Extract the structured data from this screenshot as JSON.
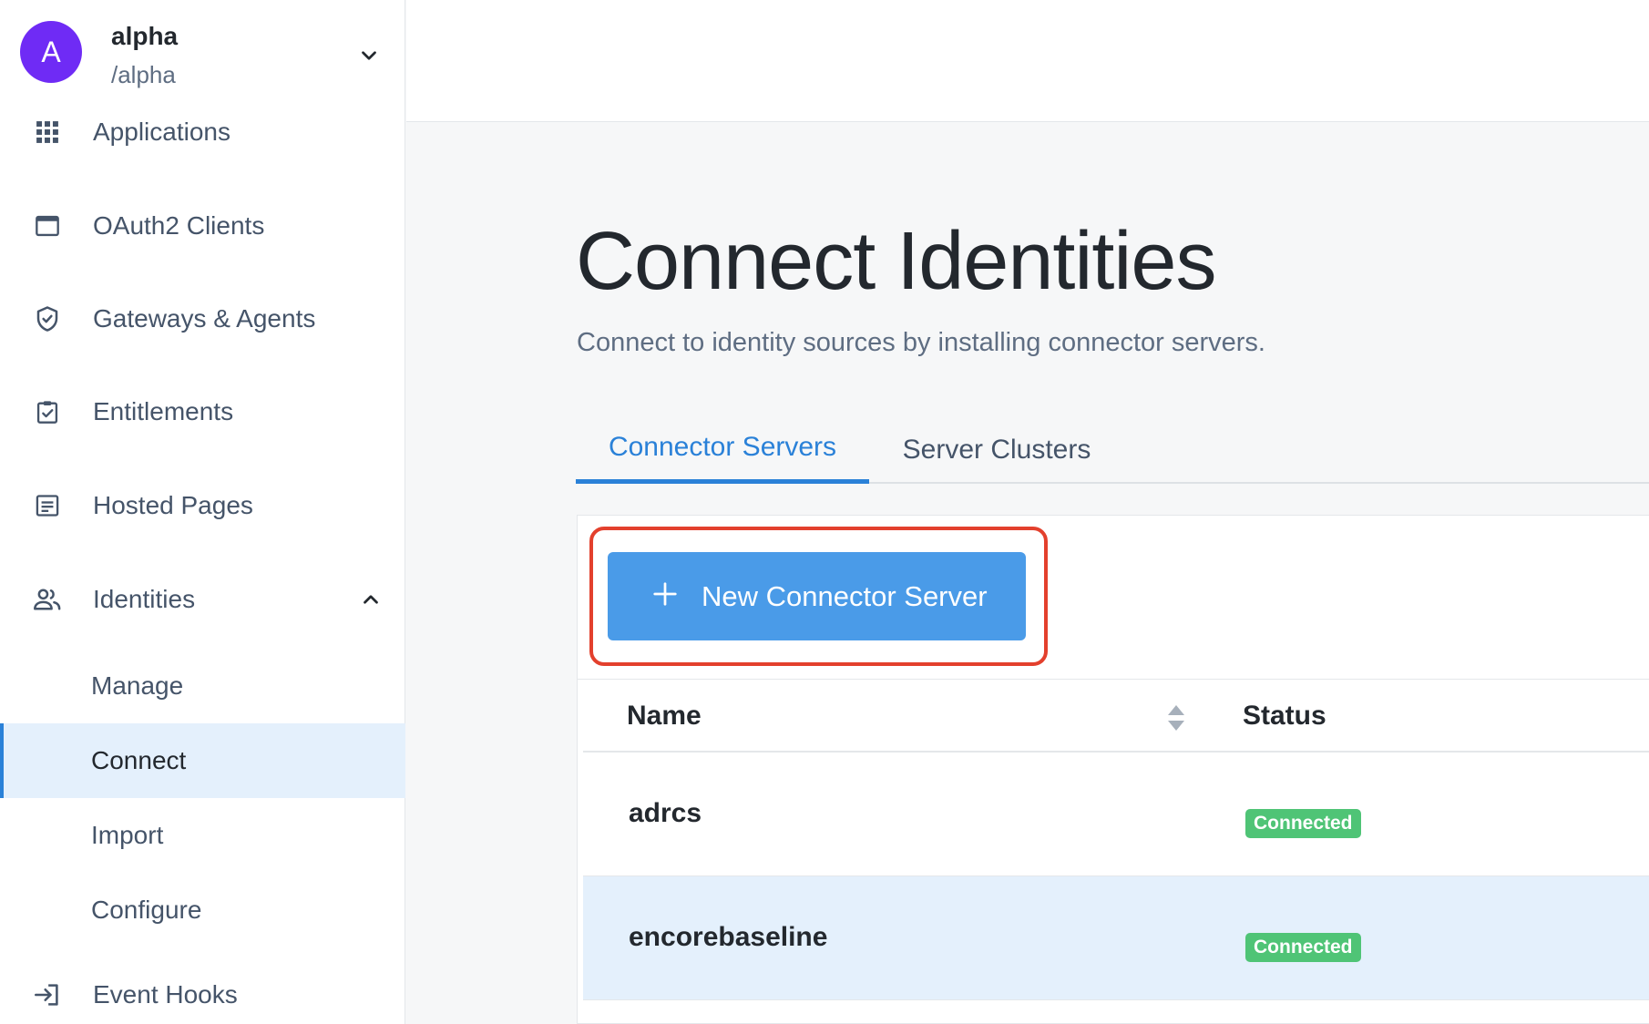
{
  "realm": {
    "initial": "A",
    "name": "alpha",
    "path": "/alpha"
  },
  "sidebar": {
    "items": [
      {
        "label": "Applications",
        "icon": "grid-icon"
      },
      {
        "label": "OAuth2 Clients",
        "icon": "window-icon"
      },
      {
        "label": "Gateways & Agents",
        "icon": "shield-check-icon"
      },
      {
        "label": "Entitlements",
        "icon": "clipboard-check-icon"
      },
      {
        "label": "Hosted Pages",
        "icon": "page-icon"
      },
      {
        "label": "Identities",
        "icon": "people-icon",
        "expanded": true
      },
      {
        "label": "Event Hooks",
        "icon": "login-arrow-icon"
      }
    ],
    "identities_sub": [
      "Manage",
      "Connect",
      "Import",
      "Configure"
    ],
    "active_sub": "Connect"
  },
  "main": {
    "title": "Connect Identities",
    "subtitle": "Connect to identity sources by installing connector servers.",
    "tabs": [
      {
        "label": "Connector Servers",
        "active": true
      },
      {
        "label": "Server Clusters",
        "active": false
      }
    ],
    "new_button_label": "New Connector Server",
    "table": {
      "headers": {
        "name": "Name",
        "status": "Status"
      },
      "rows": [
        {
          "name": "adrcs",
          "status": "Connected"
        },
        {
          "name": "encorebaseline",
          "status": "Connected"
        }
      ]
    }
  },
  "colors": {
    "accent": "#2a81d8",
    "button": "#4a9be8",
    "avatar": "#6f2bf5",
    "status_connected": "#4fc476",
    "highlight": "#e3402d",
    "selected_row": "#e4f0fc"
  }
}
